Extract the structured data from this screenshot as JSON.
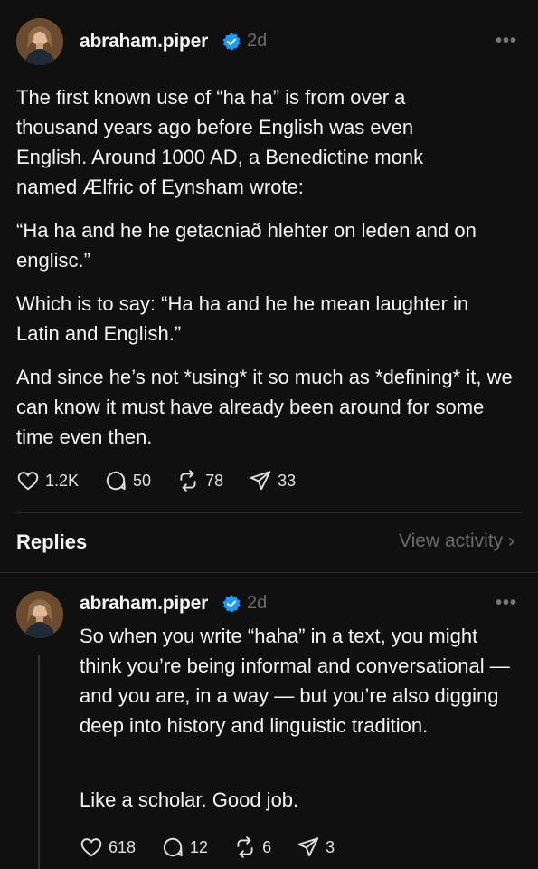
{
  "post": {
    "username": "abraham.piper",
    "time": "2d",
    "paragraphs": [
      "The first known use of “ha ha” is from over a thousand years ago before English was even English. Around 1000 AD, a Benedictine monk named Ælfric of Eynsham wrote:",
      "“Ha ha and he he getacniað hlehter on leden and on englisc.”",
      "Which is to say: “Ha ha and he he mean laughter in Latin and English.”",
      "And since he’s not *using* it so much as *defining* it, we can know it must have already been around for some time even then."
    ],
    "stats": {
      "likes": "1.2K",
      "comments": "50",
      "reposts": "78",
      "shares": "33"
    }
  },
  "replies_header": {
    "title": "Replies",
    "view_activity": "View activity"
  },
  "reply": {
    "username": "abraham.piper",
    "time": "2d",
    "paragraphs": [
      "So when you write “haha” in a text, you might think you’re being informal and conversational — and you are, in a way — but you’re also digging deep into history and linguistic tradition.",
      "Like a scholar. Good job."
    ],
    "stats": {
      "likes": "618",
      "comments": "12",
      "reposts": "6",
      "shares": "3"
    }
  },
  "colors": {
    "background": "#101010",
    "text": "#f3f5f7",
    "muted": "#6b6b6b",
    "verified": "#1d9bf0"
  }
}
